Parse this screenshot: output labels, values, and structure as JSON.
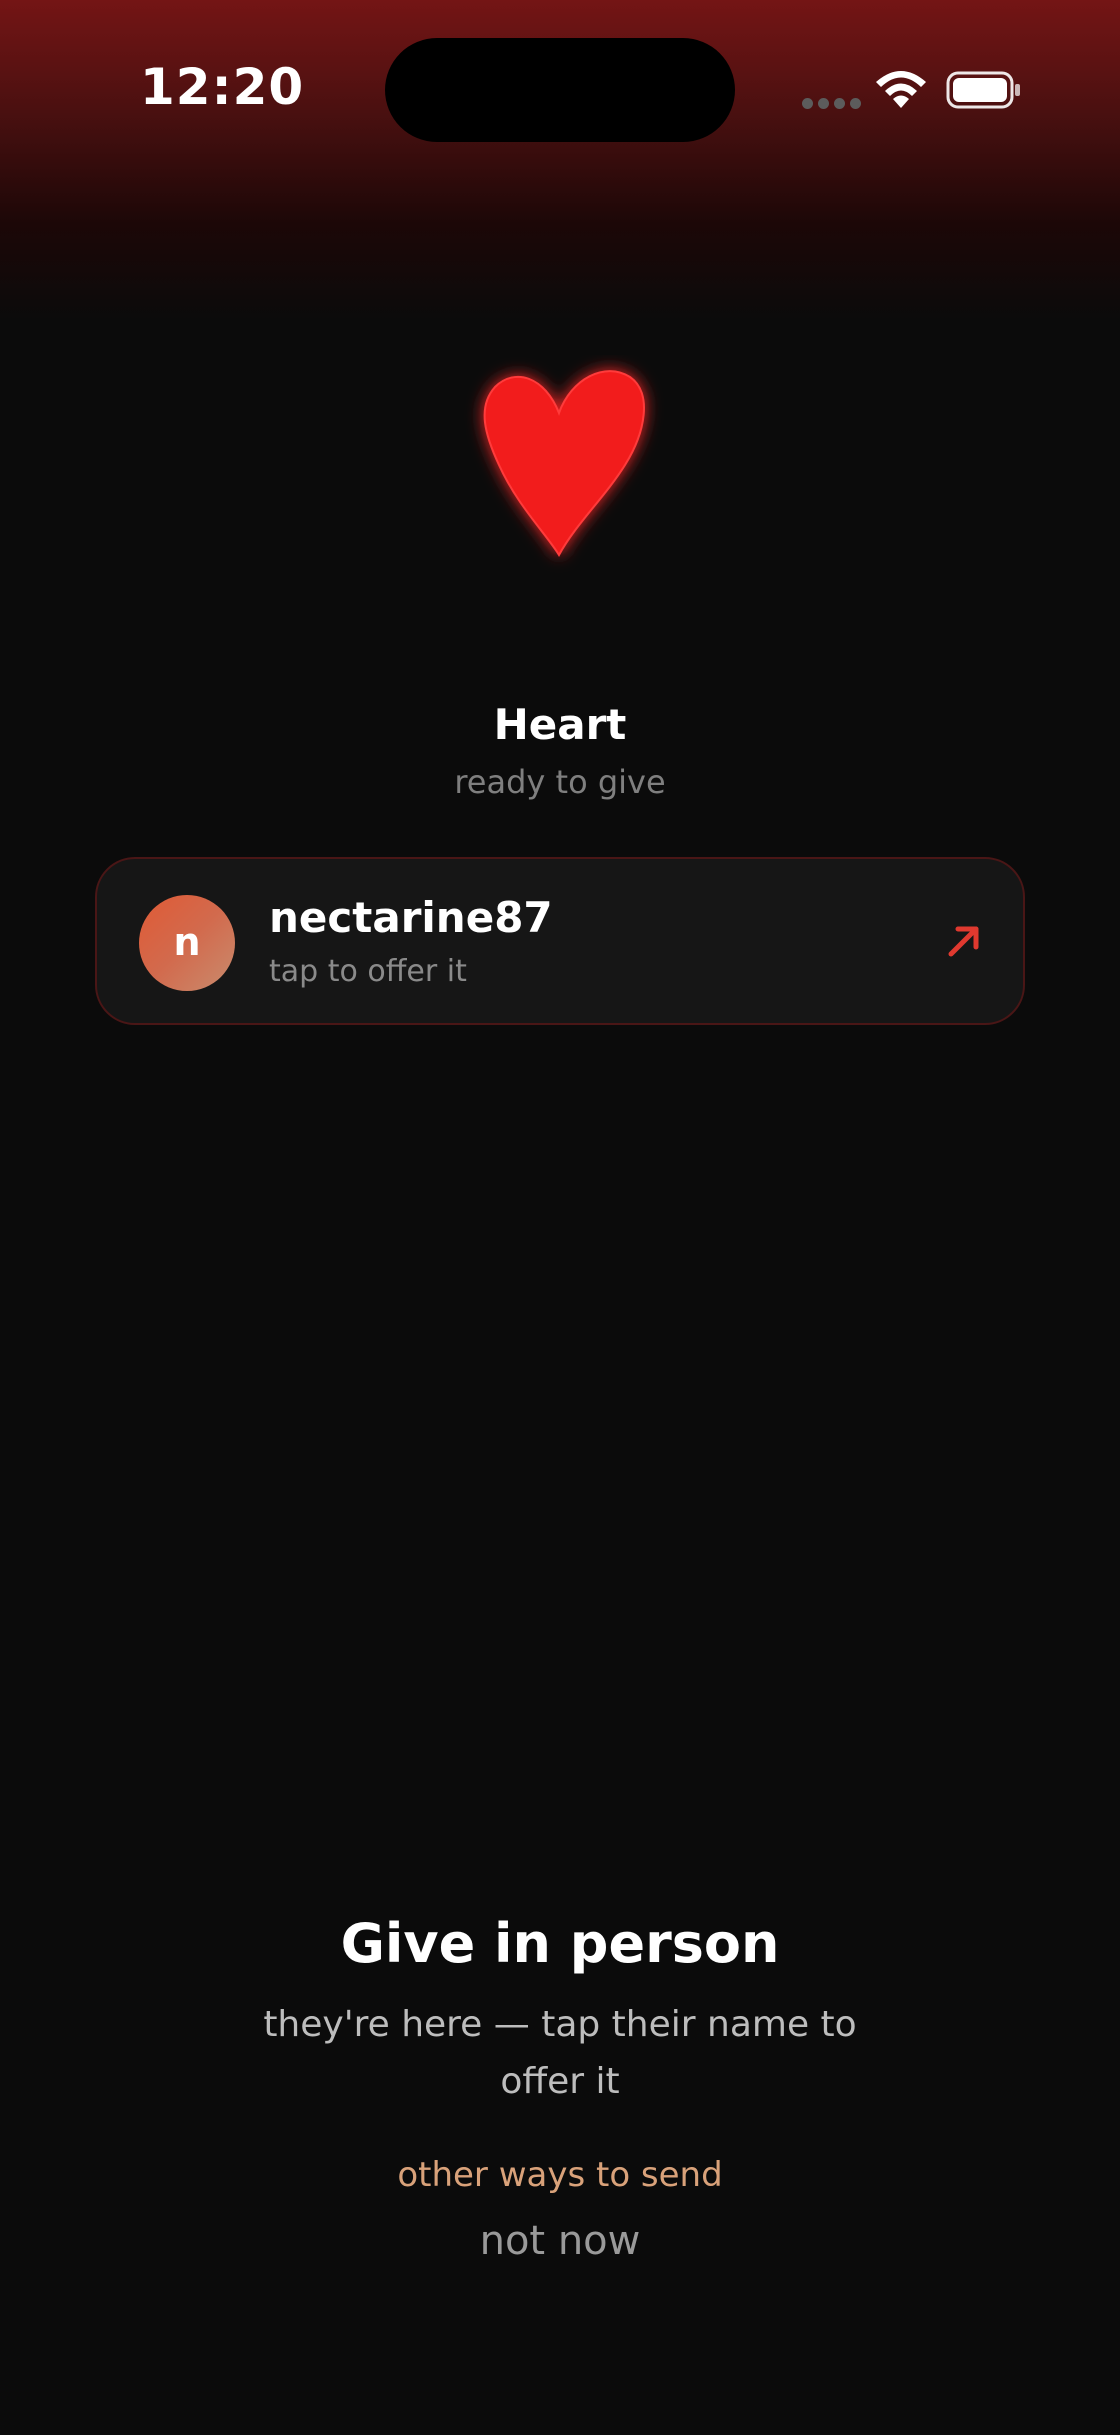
{
  "status_bar": {
    "time": "12:20"
  },
  "item": {
    "name": "Heart",
    "status": "ready to give",
    "icon": "heart-icon",
    "color": "#f21e1e"
  },
  "recipient": {
    "initial": "n",
    "username": "nectarine87",
    "hint": "tap to offer it",
    "action_icon": "arrow-up-right-icon",
    "accent_color": "#e0392f"
  },
  "give_in_person": {
    "title": "Give in person",
    "description": "they're here — tap their name to offer it",
    "other_ways_label": "other ways to send",
    "dismiss_label": "not now"
  },
  "colors": {
    "background": "#0b0b0b",
    "top_gradient": "#741515",
    "link": "#d9a27a"
  }
}
